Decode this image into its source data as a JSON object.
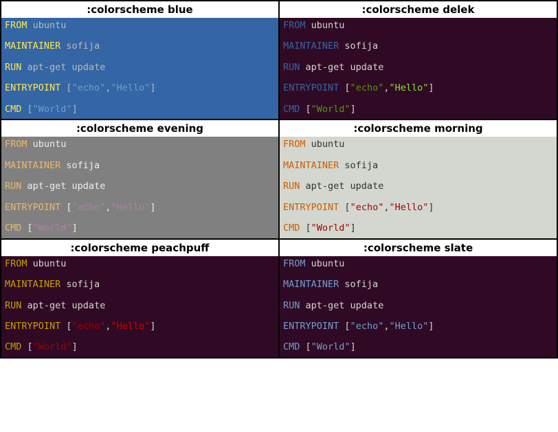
{
  "schemes": [
    {
      "title": ":colorscheme blue",
      "bg": "#3465a4",
      "colors": {
        "keyword": "#fce94f",
        "identifier": "#babdb6",
        "str1": "#729fcf",
        "str2": "#729fcf",
        "punct": "#babdb6"
      }
    },
    {
      "title": ":colorscheme delek",
      "bg": "#300a24",
      "colors": {
        "keyword": "#3465a4",
        "identifier": "#d3d7cf",
        "str1": "#4e9a06",
        "str2": "#8ae234",
        "punct": "#d3d7cf"
      }
    },
    {
      "title": ":colorscheme evening",
      "bg": "#808080",
      "colors": {
        "keyword": "#e9b96e",
        "identifier": "#eeeeec",
        "str1": "#ad7fa8",
        "str2": "#ad7fa8",
        "punct": "#eeeeec"
      }
    },
    {
      "title": ":colorscheme morning",
      "bg": "#d3d7cf",
      "colors": {
        "keyword": "#ce5c00",
        "identifier": "#2e3436",
        "str1": "#a40000",
        "str2": "#a40000",
        "punct": "#2e3436"
      }
    },
    {
      "title": ":colorscheme peachpuff",
      "bg": "#300a24",
      "colors": {
        "keyword": "#c4a000",
        "identifier": "#d3d7cf",
        "str1": "#a40000",
        "str2": "#cc0000",
        "punct": "#d3d7cf"
      }
    },
    {
      "title": ":colorscheme slate",
      "bg": "#300a24",
      "colors": {
        "keyword": "#729fcf",
        "identifier": "#d3d7cf",
        "str1": "#729fcf",
        "str2": "#729fcf",
        "punct": "#d3d7cf"
      }
    }
  ],
  "labels": {
    "from": "FROM",
    "ubuntu": "ubuntu",
    "maintainer": "MAINTAINER",
    "sofija": "sofija",
    "run": "RUN",
    "aptget": "apt-get update",
    "entrypoint": "ENTRYPOINT",
    "lbrack": "[",
    "rbrack": "]",
    "comma": ",",
    "echo": "\"echo\"",
    "hello": "\"Hello\"",
    "cmd": "CMD",
    "world": "\"World\""
  }
}
